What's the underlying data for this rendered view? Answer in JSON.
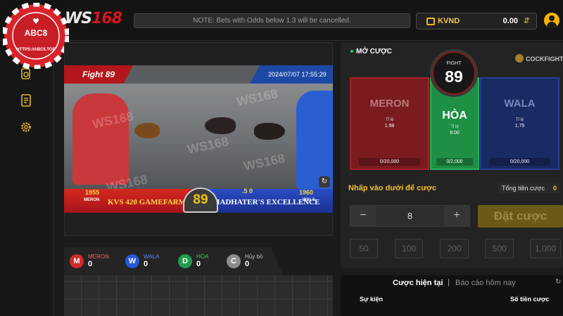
{
  "header": {
    "brand_prefix": "WS",
    "brand_suffix": "168",
    "notice": "NOTE: Bets with Odds below 1.3 will be cancelled.",
    "currency": "KVND",
    "balance": "0.00"
  },
  "watermark": {
    "text": "ABC8",
    "url": "HTTPS://ABC8.TOP"
  },
  "sidebar": {
    "icons": [
      "wallet-icon",
      "document-icon",
      "gear-icon"
    ]
  },
  "video": {
    "fight_label": "Fight 89",
    "datetime": "2024/07/07 17:55:29",
    "overlay_text": [
      "WS168",
      "WS168",
      "WS168",
      "WS168",
      "WS168"
    ],
    "scoreboard": {
      "left_number": "1955",
      "left_side": "MERON",
      "left_name": "KVS 420 GAMEFARM",
      "fight_number": "89",
      "right_number": "1960",
      "right_side": "WALA",
      "right_name": "MADHATER'S EXCELLENCE",
      "odd_hint": ".5 0"
    }
  },
  "stats": [
    {
      "letter": "M",
      "label": "MERON",
      "count": "0",
      "color": "#d42a2a",
      "label_color": "#ff5b5b"
    },
    {
      "letter": "W",
      "label": "WALA",
      "count": "0",
      "color": "#2756d8",
      "label_color": "#5f87ff"
    },
    {
      "letter": "D",
      "label": "HÒA",
      "count": "0",
      "color": "#229b4e",
      "label_color": "#38c46a"
    },
    {
      "letter": "C",
      "label": "Hủy bỏ",
      "count": "0",
      "color": "#8d8d8d",
      "label_color": "#c5c5c5"
    }
  ],
  "betting": {
    "status": "MỞ CƯỢC",
    "game": "COCKFIGHT",
    "fight_label": "FIGHT",
    "fight_number": "89",
    "meron": {
      "name": "MERON",
      "odd_label": "Tỉ lệ",
      "odd": "1.98",
      "total": "0/20,000"
    },
    "draw": {
      "name": "HÒA",
      "odd_label": "Tỉ lệ",
      "odd": "8.00",
      "total": "0/2,000"
    },
    "wala": {
      "name": "WALA",
      "odd_label": "Tỉ lệ",
      "odd": "1.75",
      "total": "0/20,000"
    },
    "tap_label": "Nhấp vào dưới để cược",
    "total_bet_label": "Tổng tiền cược",
    "total_bet_value": "0",
    "stepper": {
      "minus": "−",
      "value": "8",
      "plus": "+"
    },
    "place_bet": "Đặt cược",
    "chips": [
      "50",
      "100",
      "200",
      "500",
      "1,000"
    ]
  },
  "bets_panel": {
    "tab_current": "Cược hiện tại",
    "tab_separator": "|",
    "tab_report": "Báo cáo hôm nay",
    "col_event": "Sự kiện",
    "col_amount": "Số tiền cược"
  },
  "colors": {
    "accent": "#f4c22b",
    "meron": "#7a1b1f",
    "draw": "#1e8f45",
    "wala": "#1a2a63"
  }
}
